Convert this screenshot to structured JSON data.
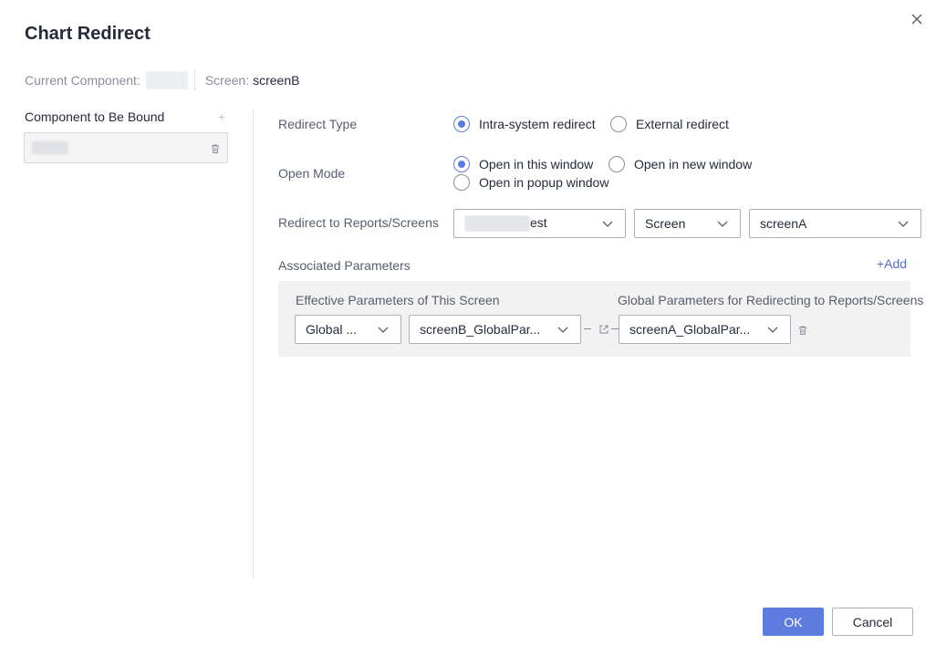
{
  "dialog": {
    "title": "Chart Redirect",
    "current_component_label": "Current Component:",
    "screen_label": "Screen:",
    "screen_value": "screenB"
  },
  "left_panel": {
    "heading": "Component to Be Bound",
    "add_symbol": "+"
  },
  "form": {
    "redirect_type_label": "Redirect Type",
    "redirect_type_options": [
      "Intra-system redirect",
      "External redirect"
    ],
    "redirect_type_selected": "Intra-system redirect",
    "open_mode_label": "Open Mode",
    "open_mode_options": [
      "Open in this window",
      "Open in new window",
      "Open in popup window"
    ],
    "open_mode_selected": "Open in this window",
    "redirect_target_label": "Redirect to Reports/Screens",
    "report_select_value_suffix": "est",
    "type_select_value": "Screen",
    "screen_select_value": "screenA"
  },
  "associated_parameters": {
    "label": "Associated Parameters",
    "add_label": "+Add",
    "left_header": "Effective Parameters of This Screen",
    "right_header": "Global Parameters for Redirecting to Reports/Screens",
    "row": {
      "scope_value": "Global ...",
      "source_param": "screenB_GlobalPar...",
      "target_param": "screenA_GlobalPar..."
    }
  },
  "footer": {
    "ok_label": "OK",
    "cancel_label": "Cancel"
  },
  "colors": {
    "accent": "#5e7ce0",
    "link": "#526ecc",
    "text": "#252b3a",
    "muted": "#8a8e99",
    "param_bg": "#f2f2f3"
  }
}
